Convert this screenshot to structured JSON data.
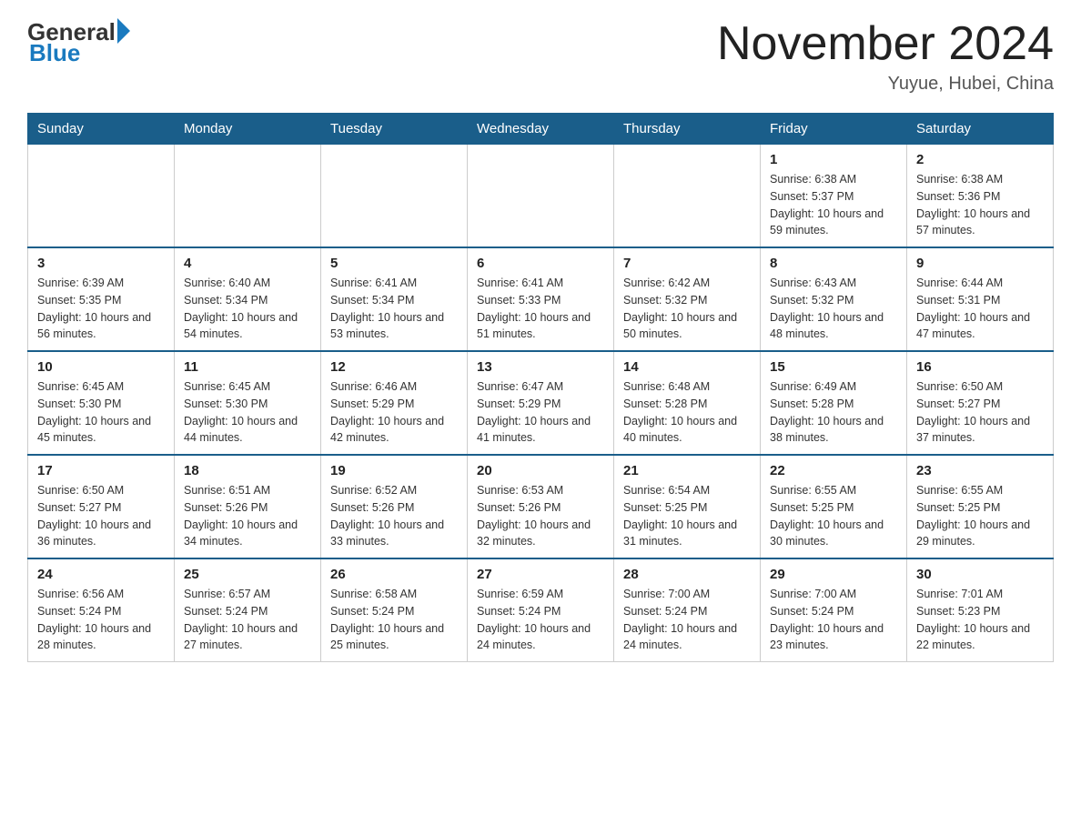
{
  "logo": {
    "general": "General",
    "blue": "Blue"
  },
  "title": {
    "month_year": "November 2024",
    "location": "Yuyue, Hubei, China"
  },
  "weekdays": [
    "Sunday",
    "Monday",
    "Tuesday",
    "Wednesday",
    "Thursday",
    "Friday",
    "Saturday"
  ],
  "weeks": [
    [
      {
        "day": "",
        "info": ""
      },
      {
        "day": "",
        "info": ""
      },
      {
        "day": "",
        "info": ""
      },
      {
        "day": "",
        "info": ""
      },
      {
        "day": "",
        "info": ""
      },
      {
        "day": "1",
        "info": "Sunrise: 6:38 AM\nSunset: 5:37 PM\nDaylight: 10 hours and 59 minutes."
      },
      {
        "day": "2",
        "info": "Sunrise: 6:38 AM\nSunset: 5:36 PM\nDaylight: 10 hours and 57 minutes."
      }
    ],
    [
      {
        "day": "3",
        "info": "Sunrise: 6:39 AM\nSunset: 5:35 PM\nDaylight: 10 hours and 56 minutes."
      },
      {
        "day": "4",
        "info": "Sunrise: 6:40 AM\nSunset: 5:34 PM\nDaylight: 10 hours and 54 minutes."
      },
      {
        "day": "5",
        "info": "Sunrise: 6:41 AM\nSunset: 5:34 PM\nDaylight: 10 hours and 53 minutes."
      },
      {
        "day": "6",
        "info": "Sunrise: 6:41 AM\nSunset: 5:33 PM\nDaylight: 10 hours and 51 minutes."
      },
      {
        "day": "7",
        "info": "Sunrise: 6:42 AM\nSunset: 5:32 PM\nDaylight: 10 hours and 50 minutes."
      },
      {
        "day": "8",
        "info": "Sunrise: 6:43 AM\nSunset: 5:32 PM\nDaylight: 10 hours and 48 minutes."
      },
      {
        "day": "9",
        "info": "Sunrise: 6:44 AM\nSunset: 5:31 PM\nDaylight: 10 hours and 47 minutes."
      }
    ],
    [
      {
        "day": "10",
        "info": "Sunrise: 6:45 AM\nSunset: 5:30 PM\nDaylight: 10 hours and 45 minutes."
      },
      {
        "day": "11",
        "info": "Sunrise: 6:45 AM\nSunset: 5:30 PM\nDaylight: 10 hours and 44 minutes."
      },
      {
        "day": "12",
        "info": "Sunrise: 6:46 AM\nSunset: 5:29 PM\nDaylight: 10 hours and 42 minutes."
      },
      {
        "day": "13",
        "info": "Sunrise: 6:47 AM\nSunset: 5:29 PM\nDaylight: 10 hours and 41 minutes."
      },
      {
        "day": "14",
        "info": "Sunrise: 6:48 AM\nSunset: 5:28 PM\nDaylight: 10 hours and 40 minutes."
      },
      {
        "day": "15",
        "info": "Sunrise: 6:49 AM\nSunset: 5:28 PM\nDaylight: 10 hours and 38 minutes."
      },
      {
        "day": "16",
        "info": "Sunrise: 6:50 AM\nSunset: 5:27 PM\nDaylight: 10 hours and 37 minutes."
      }
    ],
    [
      {
        "day": "17",
        "info": "Sunrise: 6:50 AM\nSunset: 5:27 PM\nDaylight: 10 hours and 36 minutes."
      },
      {
        "day": "18",
        "info": "Sunrise: 6:51 AM\nSunset: 5:26 PM\nDaylight: 10 hours and 34 minutes."
      },
      {
        "day": "19",
        "info": "Sunrise: 6:52 AM\nSunset: 5:26 PM\nDaylight: 10 hours and 33 minutes."
      },
      {
        "day": "20",
        "info": "Sunrise: 6:53 AM\nSunset: 5:26 PM\nDaylight: 10 hours and 32 minutes."
      },
      {
        "day": "21",
        "info": "Sunrise: 6:54 AM\nSunset: 5:25 PM\nDaylight: 10 hours and 31 minutes."
      },
      {
        "day": "22",
        "info": "Sunrise: 6:55 AM\nSunset: 5:25 PM\nDaylight: 10 hours and 30 minutes."
      },
      {
        "day": "23",
        "info": "Sunrise: 6:55 AM\nSunset: 5:25 PM\nDaylight: 10 hours and 29 minutes."
      }
    ],
    [
      {
        "day": "24",
        "info": "Sunrise: 6:56 AM\nSunset: 5:24 PM\nDaylight: 10 hours and 28 minutes."
      },
      {
        "day": "25",
        "info": "Sunrise: 6:57 AM\nSunset: 5:24 PM\nDaylight: 10 hours and 27 minutes."
      },
      {
        "day": "26",
        "info": "Sunrise: 6:58 AM\nSunset: 5:24 PM\nDaylight: 10 hours and 25 minutes."
      },
      {
        "day": "27",
        "info": "Sunrise: 6:59 AM\nSunset: 5:24 PM\nDaylight: 10 hours and 24 minutes."
      },
      {
        "day": "28",
        "info": "Sunrise: 7:00 AM\nSunset: 5:24 PM\nDaylight: 10 hours and 24 minutes."
      },
      {
        "day": "29",
        "info": "Sunrise: 7:00 AM\nSunset: 5:24 PM\nDaylight: 10 hours and 23 minutes."
      },
      {
        "day": "30",
        "info": "Sunrise: 7:01 AM\nSunset: 5:23 PM\nDaylight: 10 hours and 22 minutes."
      }
    ]
  ]
}
